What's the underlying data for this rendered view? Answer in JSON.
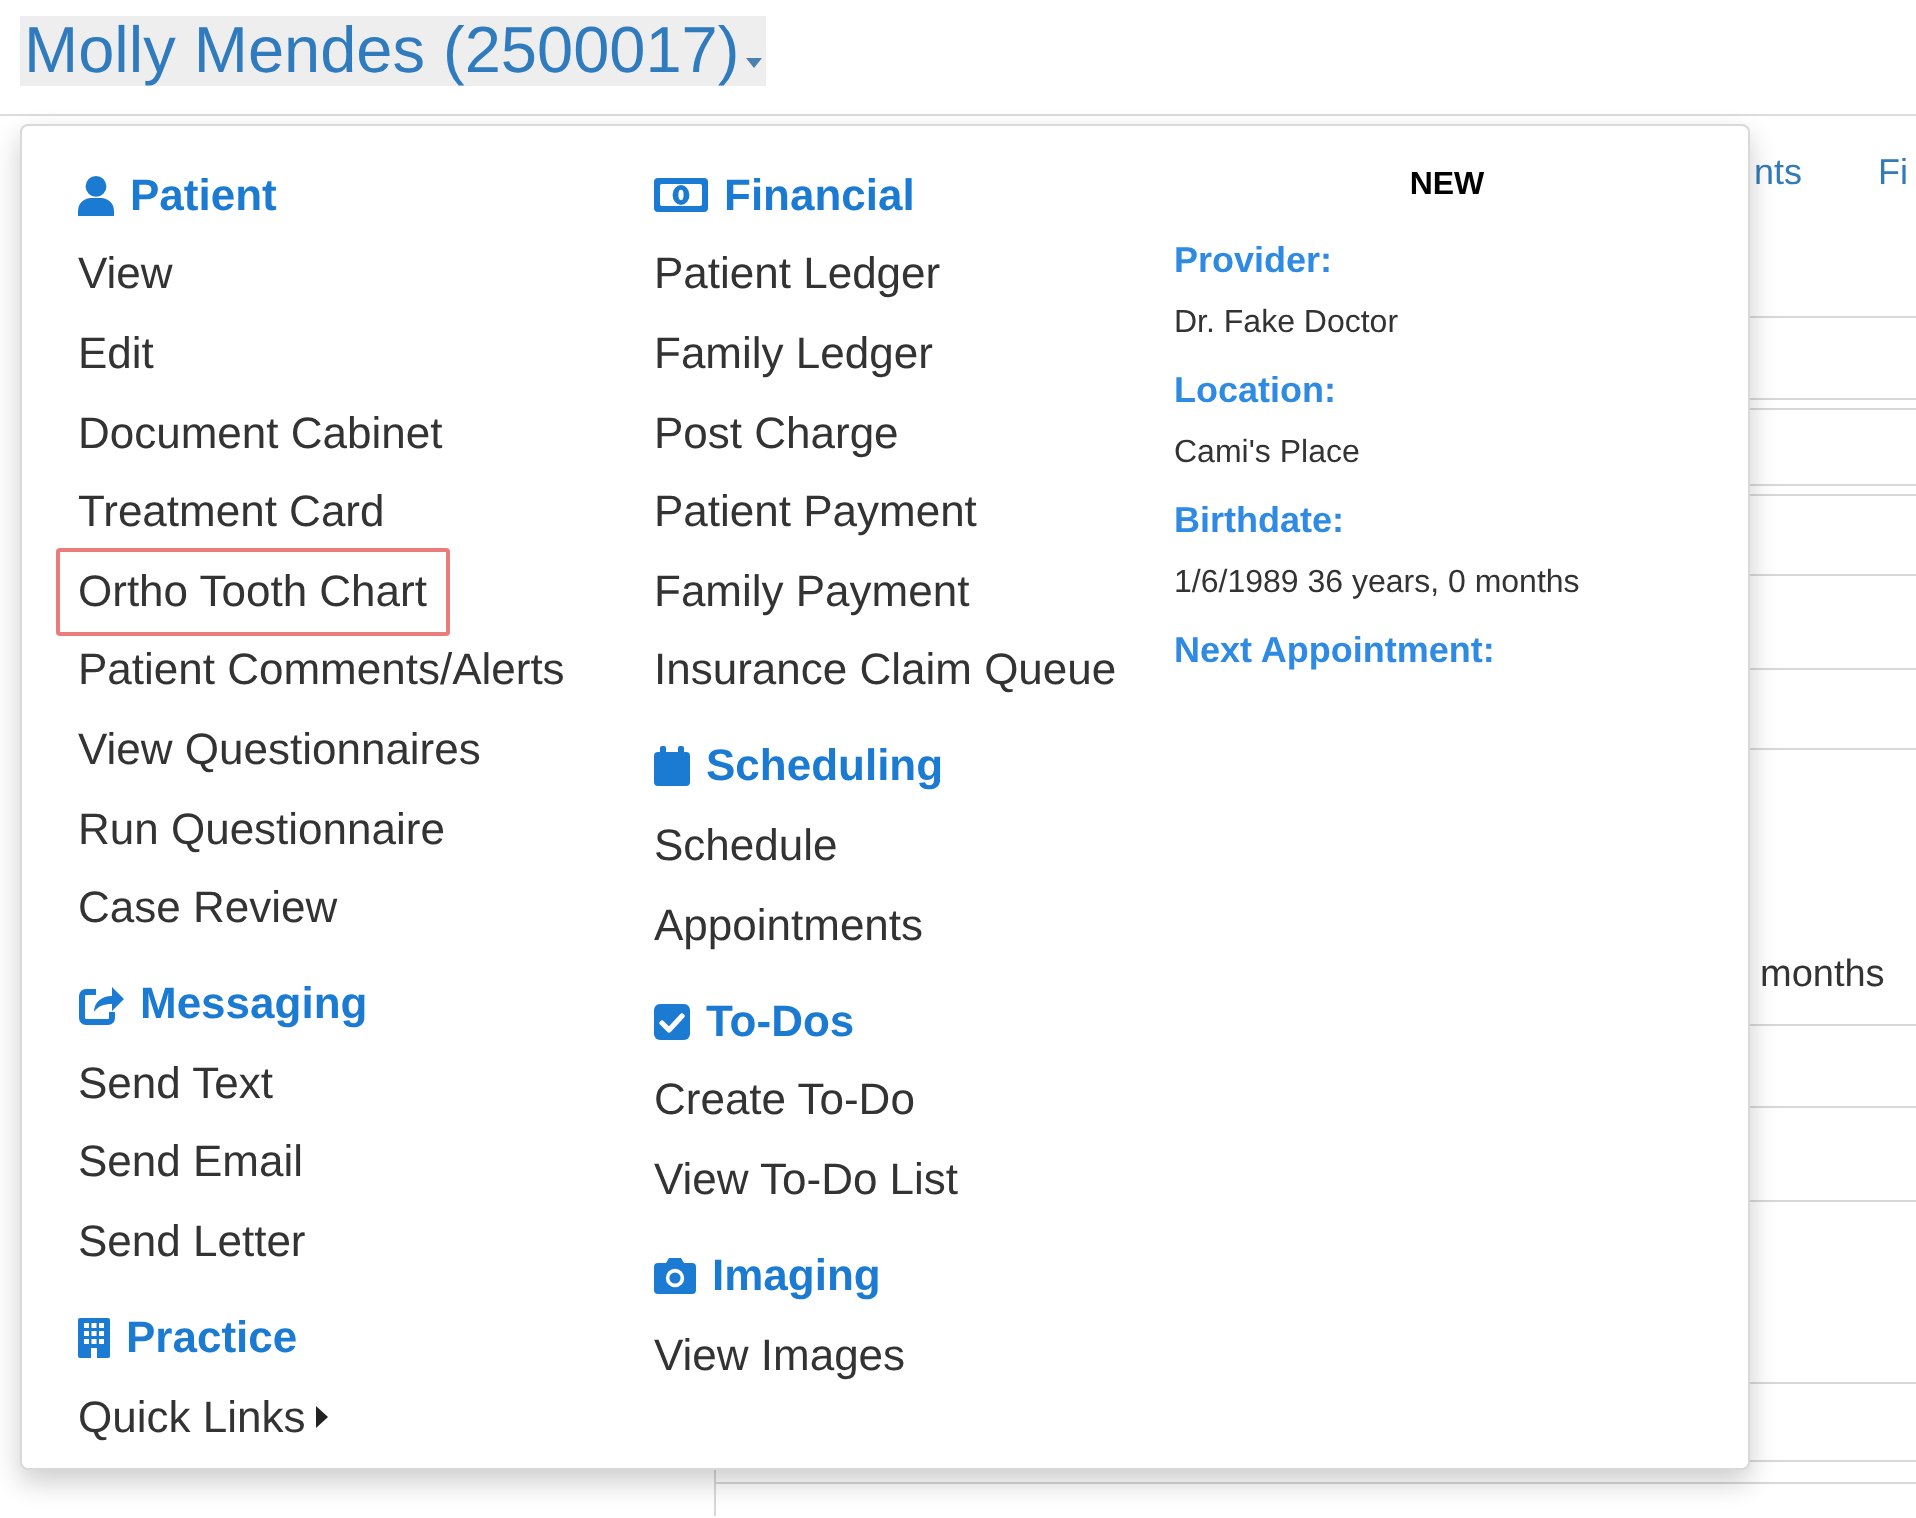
{
  "header": {
    "title": "Molly Mendes (2500017)"
  },
  "background": {
    "tabs": [
      "nts",
      "Fi"
    ],
    "table_text": "months"
  },
  "menu": {
    "columns": [
      {
        "sections": [
          {
            "kind": "patient",
            "title": "Patient",
            "items": [
              {
                "label": "View",
                "highlighted": false,
                "submenu": false
              },
              {
                "label": "Edit",
                "highlighted": false,
                "submenu": false
              },
              {
                "label": "Document Cabinet",
                "highlighted": false,
                "submenu": false
              },
              {
                "label": "Treatment Card",
                "highlighted": false,
                "submenu": false
              },
              {
                "label": "Ortho Tooth Chart",
                "highlighted": true,
                "submenu": false
              },
              {
                "label": "Patient Comments/Alerts",
                "highlighted": false,
                "submenu": false
              },
              {
                "label": "View Questionnaires",
                "highlighted": false,
                "submenu": false
              },
              {
                "label": "Run Questionnaire",
                "highlighted": false,
                "submenu": false
              },
              {
                "label": "Case Review",
                "highlighted": false,
                "submenu": false
              }
            ]
          },
          {
            "kind": "messaging",
            "title": "Messaging",
            "items": [
              {
                "label": "Send Text",
                "highlighted": false,
                "submenu": false
              },
              {
                "label": "Send Email",
                "highlighted": false,
                "submenu": false
              },
              {
                "label": "Send Letter",
                "highlighted": false,
                "submenu": false
              }
            ]
          },
          {
            "kind": "practice",
            "title": "Practice",
            "items": [
              {
                "label": "Quick Links",
                "highlighted": false,
                "submenu": true
              }
            ]
          }
        ]
      },
      {
        "sections": [
          {
            "kind": "financial",
            "title": "Financial",
            "items": [
              {
                "label": "Patient Ledger",
                "highlighted": false,
                "submenu": false
              },
              {
                "label": "Family Ledger",
                "highlighted": false,
                "submenu": false
              },
              {
                "label": "Post Charge",
                "highlighted": false,
                "submenu": false
              },
              {
                "label": "Patient Payment",
                "highlighted": false,
                "submenu": false
              },
              {
                "label": "Family Payment",
                "highlighted": false,
                "submenu": false
              },
              {
                "label": "Insurance Claim Queue",
                "highlighted": false,
                "submenu": false
              }
            ]
          },
          {
            "kind": "scheduling",
            "title": "Scheduling",
            "items": [
              {
                "label": "Schedule",
                "highlighted": false,
                "submenu": false
              },
              {
                "label": "Appointments",
                "highlighted": false,
                "submenu": false
              }
            ]
          },
          {
            "kind": "todos",
            "title": "To-Dos",
            "items": [
              {
                "label": "Create To-Do",
                "highlighted": false,
                "submenu": false
              },
              {
                "label": "View To-Do List",
                "highlighted": false,
                "submenu": false
              }
            ]
          },
          {
            "kind": "imaging",
            "title": "Imaging",
            "items": [
              {
                "label": "View Images",
                "highlighted": false,
                "submenu": false
              }
            ]
          }
        ]
      }
    ],
    "summary": {
      "badge": "NEW",
      "fields": [
        {
          "label": "Provider:",
          "value": "Dr. Fake Doctor"
        },
        {
          "label": "Location:",
          "value": "Cami's Place"
        },
        {
          "label": "Birthdate:",
          "value": "1/6/1989 36 years, 0 months"
        },
        {
          "label": "Next Appointment:"
        }
      ]
    }
  }
}
